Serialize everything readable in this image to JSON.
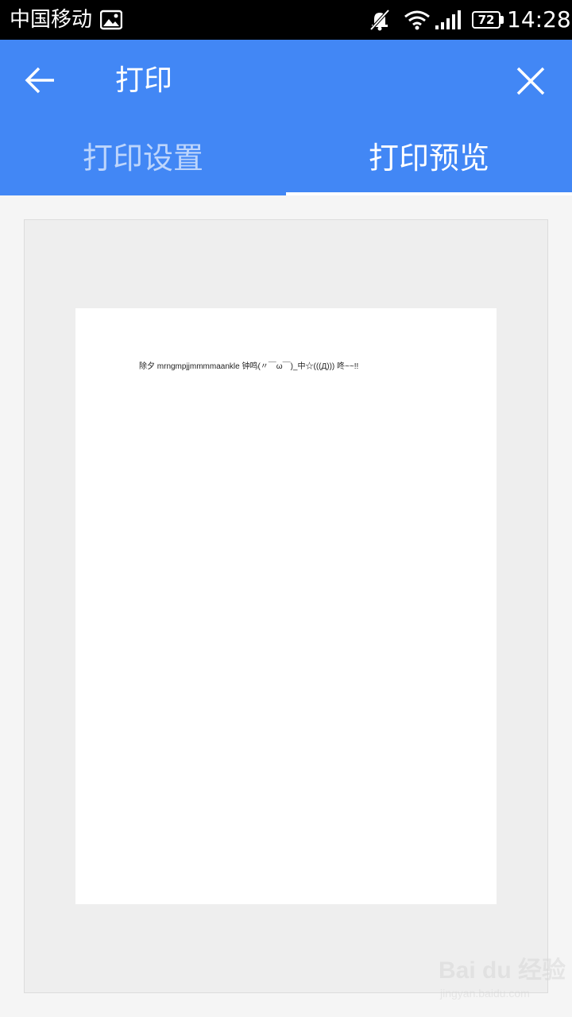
{
  "status_bar": {
    "carrier": "中国移动",
    "battery_level": "72",
    "time": "14:28",
    "icons": [
      "photo-icon",
      "mute-icon",
      "wifi-icon",
      "signal-icon",
      "battery-icon"
    ]
  },
  "app_bar": {
    "title": "打印",
    "back_icon": "arrow-left-icon",
    "close_icon": "close-icon",
    "tabs": [
      {
        "label": "打印设置",
        "selected": false
      },
      {
        "label": "打印预览",
        "selected": true
      }
    ]
  },
  "preview": {
    "page_text": "除夕 mrngmpjjmmmmaankle 钟鸣(〃￣ω￣)_中☆(((Д))) 咚~~!!"
  },
  "watermark": {
    "brand": "Bai du 经验",
    "url": "jingyan.baidu.com"
  },
  "colors": {
    "app_bar": "#4287f5",
    "preview_background": "#eeeeee",
    "page": "#ffffff"
  }
}
